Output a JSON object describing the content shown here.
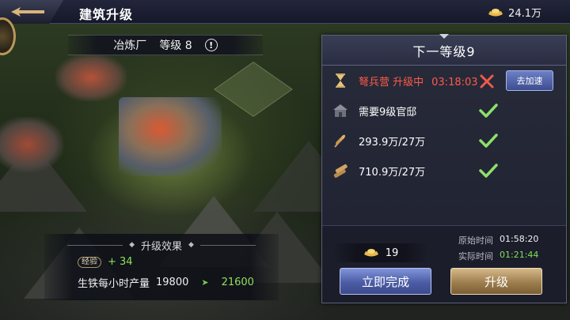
{
  "header": {
    "title": "建筑升级",
    "gold_amount": "24.1万"
  },
  "building": {
    "name": "冶炼厂",
    "level_label": "等级 8",
    "info_glyph": "!"
  },
  "effects": {
    "title": "升级效果",
    "exp_badge": "经验",
    "exp_value": "+ 34",
    "stat_name": "生铁每小时产量",
    "stat_current": "19800",
    "stat_next": "21600"
  },
  "panel": {
    "title": "下一等级9",
    "requirements": [
      {
        "icon": "hourglass-icon",
        "text": "弩兵营 升级中",
        "time": "03:18:03",
        "status": "blocked",
        "action_label": "去加速"
      },
      {
        "icon": "mansion-icon",
        "text": "需要9级官邸",
        "status": "ok"
      },
      {
        "icon": "wheat-icon",
        "text": "293.9万/27万",
        "status": "ok"
      },
      {
        "icon": "wood-icon",
        "text": "710.9万/27万",
        "status": "ok"
      }
    ],
    "cost_gold": "19",
    "original_time_label": "原始时间",
    "original_time": "01:58:20",
    "actual_time_label": "实际时间",
    "actual_time": "01:21:44",
    "instant_button": "立即完成",
    "upgrade_button": "升级"
  },
  "colors": {
    "accent_gold": "#d9b679",
    "success_green": "#7ee05a",
    "warning_red": "#ff5a4a",
    "button_blue": "#4c5ca5"
  }
}
